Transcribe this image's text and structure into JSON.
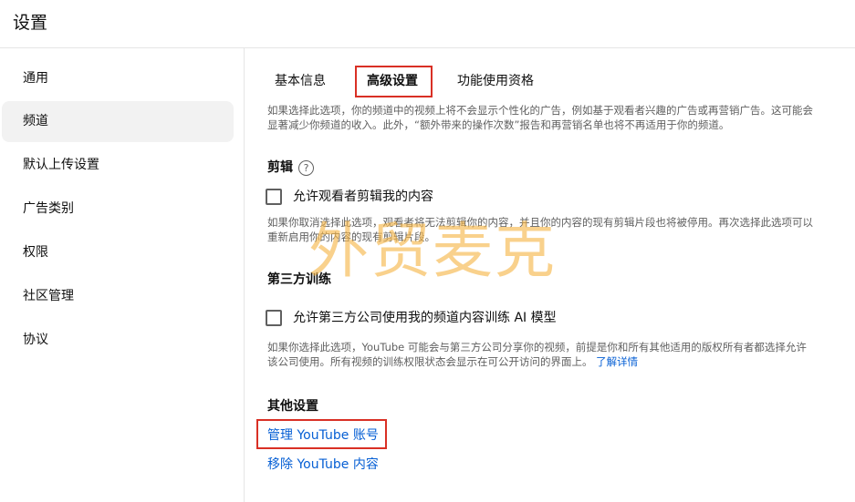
{
  "header": {
    "title": "设置"
  },
  "sidebar": {
    "items": [
      {
        "label": "通用"
      },
      {
        "label": "频道"
      },
      {
        "label": "默认上传设置"
      },
      {
        "label": "广告类别"
      },
      {
        "label": "权限"
      },
      {
        "label": "社区管理"
      },
      {
        "label": "协议"
      }
    ],
    "active_index": 1
  },
  "tabs": [
    {
      "label": "基本信息"
    },
    {
      "label": "高级设置"
    },
    {
      "label": "功能使用资格"
    }
  ],
  "active_tab_index": 1,
  "content": {
    "top_desc": "如果选择此选项，你的频道中的视频上将不会显示个性化的广告，例如基于观看者兴趣的广告或再营销广告。这可能会显著减少你频道的收入。此外，“额外带来的操作次数”报告和再营销名单也将不再适用于你的频道。",
    "clip": {
      "title": "剪辑",
      "help_glyph": "?",
      "checkbox_label": "允许观看者剪辑我的内容",
      "checked": false,
      "desc": "如果你取消选择此选项，观看者将无法剪辑你的内容，并且你的内容的现有剪辑片段也将被停用。再次选择此选项可以重新启用你的内容的现有剪辑片段。"
    },
    "third_party": {
      "title": "第三方训练",
      "checkbox_label": "允许第三方公司使用我的频道内容训练 AI 模型",
      "checked": false,
      "desc": "如果你选择此选项，YouTube 可能会与第三方公司分享你的视频，前提是你和所有其他适用的版权所有者都选择允许该公司使用。所有视频的训练权限状态会显示在可公开访问的界面上。",
      "learn_more": "了解详情"
    },
    "other": {
      "title": "其他设置",
      "manage_account": "管理 YouTube 账号",
      "remove_content": "移除 YouTube 内容"
    }
  },
  "watermark": "外贸麦克",
  "colors": {
    "link": "#065fd4",
    "highlight": "#d93025",
    "active_bg": "#f2f2f2"
  }
}
